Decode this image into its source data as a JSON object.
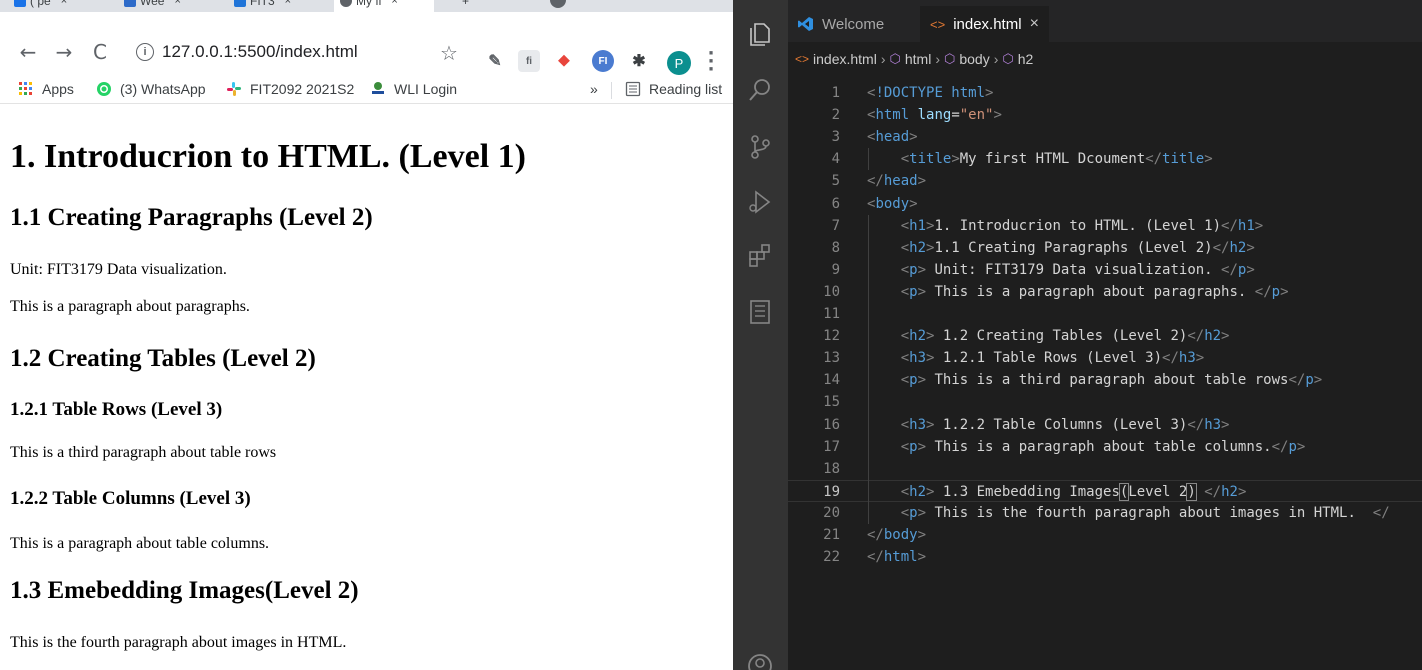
{
  "browser": {
    "tabs": [
      {
        "label": "( pe",
        "close": "×"
      },
      {
        "label": "Wee",
        "close": "×"
      },
      {
        "label": "FIT3",
        "close": "×"
      },
      {
        "label": "My fi",
        "close": "×"
      }
    ],
    "new_tab": "+",
    "url": "127.0.0.1:5500/index.html",
    "avatar_letter": "P",
    "bookmarks": [
      {
        "label": "Apps"
      },
      {
        "label": "(3) WhatsApp"
      },
      {
        "label": "FIT2092 2021S2"
      },
      {
        "label": "WLI Login"
      }
    ],
    "bookmarks_overflow": "»",
    "reading_list": "Reading list",
    "page": {
      "h1": "1. Introducrion to HTML. (Level 1)",
      "h2_1": "1.1 Creating Paragraphs (Level 2)",
      "p1": "Unit: FIT3179 Data visualization.",
      "p2": "This is a paragraph about paragraphs.",
      "h2_2": "1.2 Creating Tables (Level 2)",
      "h3_1": "1.2.1 Table Rows (Level 3)",
      "p3": "This is a third paragraph about table rows",
      "h3_2": "1.2.2 Table Columns (Level 3)",
      "p4": "This is a paragraph about table columns.",
      "h2_3": "1.3 Emebedding Images(Level 2)",
      "p5": "This is the fourth paragraph about images in HTML."
    }
  },
  "vscode": {
    "tabs": [
      {
        "label": "Welcome"
      },
      {
        "label": "index.html",
        "close": "×"
      }
    ],
    "breadcrumbs": [
      "index.html",
      "html",
      "body",
      "h2"
    ],
    "lines": [
      {
        "n": "1",
        "indent": 0,
        "tokens": [
          [
            "br",
            "<"
          ],
          [
            "doc",
            "!DOCTYPE "
          ],
          [
            "tag",
            "html"
          ],
          [
            "br",
            ">"
          ]
        ]
      },
      {
        "n": "2",
        "indent": 0,
        "tokens": [
          [
            "br",
            "<"
          ],
          [
            "tag",
            "html "
          ],
          [
            "attr",
            "lang"
          ],
          [
            "txt",
            "="
          ],
          [
            "str",
            "\"en\""
          ],
          [
            "br",
            ">"
          ]
        ]
      },
      {
        "n": "3",
        "indent": 0,
        "tokens": [
          [
            "br",
            "<"
          ],
          [
            "tag",
            "head"
          ],
          [
            "br",
            ">"
          ]
        ]
      },
      {
        "n": "4",
        "indent": 1,
        "tokens": [
          [
            "br",
            "<"
          ],
          [
            "tag",
            "title"
          ],
          [
            "br",
            ">"
          ],
          [
            "txt",
            "My first HTML Dcoument"
          ],
          [
            "br",
            "</"
          ],
          [
            "tag",
            "title"
          ],
          [
            "br",
            ">"
          ]
        ]
      },
      {
        "n": "5",
        "indent": 0,
        "tokens": [
          [
            "br",
            "</"
          ],
          [
            "tag",
            "head"
          ],
          [
            "br",
            ">"
          ]
        ]
      },
      {
        "n": "6",
        "indent": 0,
        "tokens": [
          [
            "br",
            "<"
          ],
          [
            "tag",
            "body"
          ],
          [
            "br",
            ">"
          ]
        ]
      },
      {
        "n": "7",
        "indent": 1,
        "tokens": [
          [
            "br",
            "<"
          ],
          [
            "tag",
            "h1"
          ],
          [
            "br",
            ">"
          ],
          [
            "txt",
            "1. Introducrion to HTML. (Level 1)"
          ],
          [
            "br",
            "</"
          ],
          [
            "tag",
            "h1"
          ],
          [
            "br",
            ">"
          ]
        ]
      },
      {
        "n": "8",
        "indent": 1,
        "tokens": [
          [
            "br",
            "<"
          ],
          [
            "tag",
            "h2"
          ],
          [
            "br",
            ">"
          ],
          [
            "txt",
            "1.1 Creating Paragraphs (Level 2)"
          ],
          [
            "br",
            "</"
          ],
          [
            "tag",
            "h2"
          ],
          [
            "br",
            ">"
          ]
        ]
      },
      {
        "n": "9",
        "indent": 1,
        "tokens": [
          [
            "br",
            "<"
          ],
          [
            "tag",
            "p"
          ],
          [
            "br",
            ">"
          ],
          [
            "txt",
            " Unit: FIT3179 Data visualization. "
          ],
          [
            "br",
            "</"
          ],
          [
            "tag",
            "p"
          ],
          [
            "br",
            ">"
          ]
        ]
      },
      {
        "n": "10",
        "indent": 1,
        "tokens": [
          [
            "br",
            "<"
          ],
          [
            "tag",
            "p"
          ],
          [
            "br",
            ">"
          ],
          [
            "txt",
            " This is a paragraph about paragraphs. "
          ],
          [
            "br",
            "</"
          ],
          [
            "tag",
            "p"
          ],
          [
            "br",
            ">"
          ]
        ]
      },
      {
        "n": "11",
        "indent": 0,
        "tokens": []
      },
      {
        "n": "12",
        "indent": 1,
        "tokens": [
          [
            "br",
            "<"
          ],
          [
            "tag",
            "h2"
          ],
          [
            "br",
            ">"
          ],
          [
            "txt",
            " 1.2 Creating Tables (Level 2)"
          ],
          [
            "br",
            "</"
          ],
          [
            "tag",
            "h2"
          ],
          [
            "br",
            ">"
          ]
        ]
      },
      {
        "n": "13",
        "indent": 1,
        "tokens": [
          [
            "br",
            "<"
          ],
          [
            "tag",
            "h3"
          ],
          [
            "br",
            ">"
          ],
          [
            "txt",
            " 1.2.1 Table Rows (Level 3)"
          ],
          [
            "br",
            "</"
          ],
          [
            "tag",
            "h3"
          ],
          [
            "br",
            ">"
          ]
        ]
      },
      {
        "n": "14",
        "indent": 1,
        "tokens": [
          [
            "br",
            "<"
          ],
          [
            "tag",
            "p"
          ],
          [
            "br",
            ">"
          ],
          [
            "txt",
            " This is a third paragraph about table rows"
          ],
          [
            "br",
            "</"
          ],
          [
            "tag",
            "p"
          ],
          [
            "br",
            ">"
          ]
        ]
      },
      {
        "n": "15",
        "indent": 0,
        "tokens": []
      },
      {
        "n": "16",
        "indent": 1,
        "tokens": [
          [
            "br",
            "<"
          ],
          [
            "tag",
            "h3"
          ],
          [
            "br",
            ">"
          ],
          [
            "txt",
            " 1.2.2 Table Columns (Level 3)"
          ],
          [
            "br",
            "</"
          ],
          [
            "tag",
            "h3"
          ],
          [
            "br",
            ">"
          ]
        ]
      },
      {
        "n": "17",
        "indent": 1,
        "tokens": [
          [
            "br",
            "<"
          ],
          [
            "tag",
            "p"
          ],
          [
            "br",
            ">"
          ],
          [
            "txt",
            " This is a paragraph about table columns."
          ],
          [
            "br",
            "</"
          ],
          [
            "tag",
            "p"
          ],
          [
            "br",
            ">"
          ]
        ]
      },
      {
        "n": "18",
        "indent": 0,
        "tokens": []
      },
      {
        "n": "19",
        "indent": 1,
        "tokens": [
          [
            "br",
            "<"
          ],
          [
            "tag",
            "h2"
          ],
          [
            "br",
            ">"
          ],
          [
            "txt",
            " 1.3 Emebedding Images"
          ],
          [
            "cur",
            "("
          ],
          [
            "txt",
            "Level 2"
          ],
          [
            "cur",
            ")"
          ],
          [
            "txt",
            " "
          ],
          [
            "br",
            "</"
          ],
          [
            "tag",
            "h2"
          ],
          [
            "br",
            ">"
          ]
        ]
      },
      {
        "n": "20",
        "indent": 1,
        "tokens": [
          [
            "br",
            "<"
          ],
          [
            "tag",
            "p"
          ],
          [
            "br",
            ">"
          ],
          [
            "txt",
            " This is the fourth paragraph about images in HTML.  "
          ],
          [
            "br",
            "</"
          ]
        ]
      },
      {
        "n": "21",
        "indent": 0,
        "tokens": [
          [
            "br",
            "</"
          ],
          [
            "tag",
            "body"
          ],
          [
            "br",
            ">"
          ]
        ]
      },
      {
        "n": "22",
        "indent": 0,
        "tokens": [
          [
            "br",
            "</"
          ],
          [
            "tag",
            "html"
          ],
          [
            "br",
            ">"
          ]
        ]
      }
    ],
    "current_line": "19"
  }
}
